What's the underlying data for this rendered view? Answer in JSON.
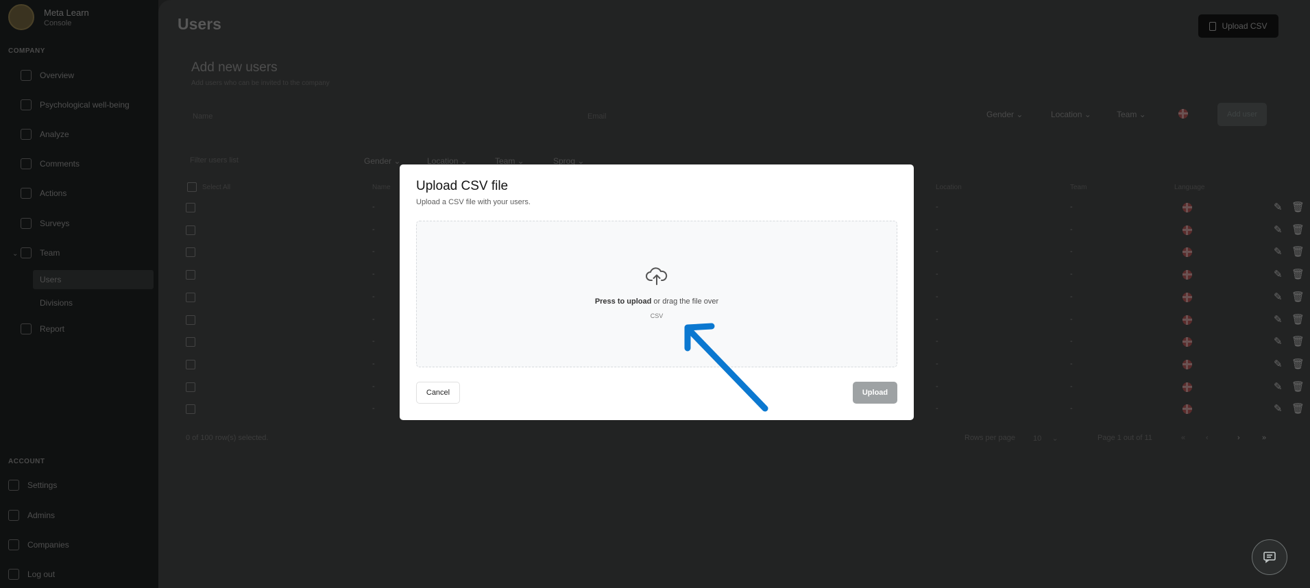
{
  "brand": {
    "name": "Meta Learn",
    "sub": "Console"
  },
  "sidebar": {
    "section_company": "COMPANY",
    "items": [
      {
        "label": "Overview",
        "icon": "grid-icon"
      },
      {
        "label": "Psychological well-being",
        "icon": "heart-icon"
      },
      {
        "label": "Analyze",
        "icon": "chart-icon"
      },
      {
        "label": "Comments",
        "icon": "comment-icon"
      },
      {
        "label": "Actions",
        "icon": "check-icon"
      },
      {
        "label": "Surveys",
        "icon": "survey-icon"
      },
      {
        "label": "Team",
        "icon": "team-icon"
      }
    ],
    "team_sub": [
      {
        "label": "Users"
      },
      {
        "label": "Divisions"
      }
    ],
    "report": "Report",
    "section_account": "ACCOUNT",
    "account_items": [
      {
        "label": "Settings",
        "icon": "gear-icon"
      },
      {
        "label": "Admins",
        "icon": "shield-icon"
      },
      {
        "label": "Companies",
        "icon": "briefcase-icon"
      },
      {
        "label": "Log out",
        "icon": "logout-icon"
      }
    ]
  },
  "header": {
    "title": "Users",
    "upload_csv": "Upload CSV"
  },
  "add_users": {
    "title": "Add new users",
    "subtitle": "Add users who can be invited to the company",
    "name_placeholder": "Name",
    "email_placeholder": "Email",
    "gender": "Gender",
    "location": "Location",
    "team": "Team",
    "add_button": "Add user"
  },
  "filters": {
    "search": "Filter users list",
    "gender": "Gender",
    "location": "Location",
    "team": "Team",
    "language": "Sprog"
  },
  "table": {
    "headers": {
      "select": "Select All",
      "name": "Name",
      "location": "Location",
      "team": "Team",
      "language": "Language"
    },
    "rows": [
      {
        "name": "-",
        "location": "-",
        "team": "-"
      },
      {
        "name": "-",
        "location": "-",
        "team": "-"
      },
      {
        "name": "-",
        "location": "-",
        "team": "-"
      },
      {
        "name": "-",
        "location": "-",
        "team": "-"
      },
      {
        "name": "-",
        "location": "-",
        "team": "-"
      },
      {
        "name": "-",
        "location": "-",
        "team": "-"
      },
      {
        "name": "-",
        "location": "-",
        "team": "-"
      },
      {
        "name": "-",
        "location": "-",
        "team": "-"
      },
      {
        "name": "-",
        "location": "-",
        "team": "-"
      },
      {
        "name": "-",
        "location": "-",
        "team": "-"
      }
    ],
    "footer": {
      "selected": "0 of 100 row(s) selected.",
      "rows_per_page_label": "Rows per page",
      "rows_per_page": "10",
      "page": "Page 1 out of 11"
    }
  },
  "modal": {
    "title": "Upload CSV file",
    "description": "Upload a CSV file with your users.",
    "drop_strong": "Press to upload",
    "drop_rest": " or drag the file over",
    "hint": "CSV",
    "cancel": "Cancel",
    "upload": "Upload"
  },
  "colors": {
    "arrow": "#0b78d0",
    "overlay": "#1b1c1c",
    "upload_disabled": "#9ea2a4"
  }
}
